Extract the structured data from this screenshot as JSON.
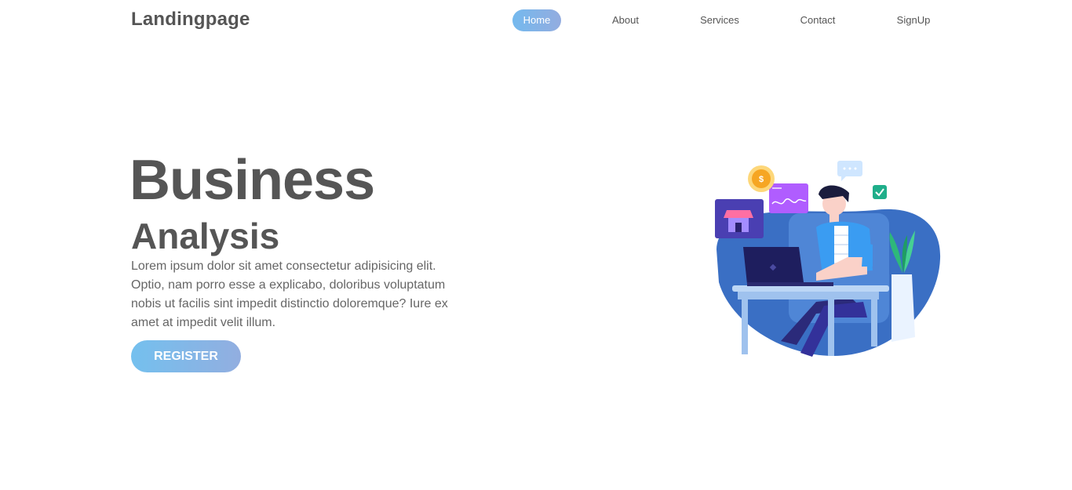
{
  "header": {
    "logo": "Landingpage",
    "nav": [
      {
        "label": "Home",
        "active": true
      },
      {
        "label": "About",
        "active": false
      },
      {
        "label": "Services",
        "active": false
      },
      {
        "label": "Contact",
        "active": false
      },
      {
        "label": "SignUp",
        "active": false
      }
    ]
  },
  "hero": {
    "title": "Business",
    "subtitle": "Analysis",
    "text": "Lorem ipsum dolor sit amet consectetur adipisicing elit. Optio, nam porro esse a explicabo, doloribus voluptatum nobis ut facilis sint impedit distinctio doloremque? Iure ex amet at impedit velit illum.",
    "register_label": "REGISTER"
  },
  "illustration": {
    "coin_symbol": "$",
    "icons": [
      "coin-icon",
      "chart-card-icon",
      "chat-bubble-icon",
      "checkmark-icon",
      "shop-icon",
      "laptop-icon",
      "plant-icon"
    ]
  },
  "colors": {
    "text": "#555555",
    "button_gradient_start": "#74c0ee",
    "button_gradient_end": "#92aee0",
    "blob_blue": "#3a6fc4"
  }
}
